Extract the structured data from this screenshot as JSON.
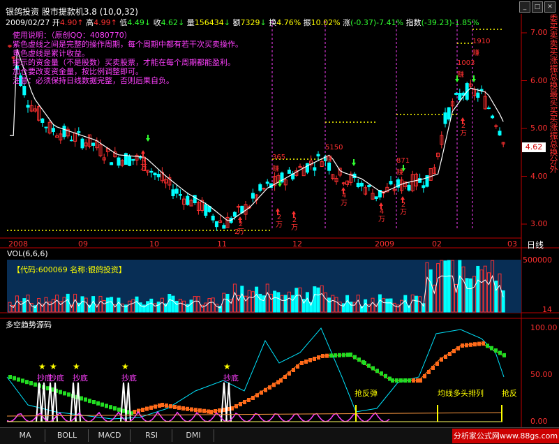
{
  "header": {
    "stock": "银鸽投资",
    "indicator": "股市提款机3.8 (10,0,32)",
    "date": "2009/02/27",
    "open_label": "开",
    "open": "4.90",
    "high_label": "高",
    "high": "4.99",
    "low_label": "低",
    "low": "4.49",
    "close_label": "收",
    "close": "4.62",
    "vol_label": "量",
    "vol": "156434",
    "amount_label": "额",
    "amount": "7329",
    "turnover_label": "换",
    "turnover": "4.76%",
    "amplitude_label": "振",
    "amplitude": "10.02%",
    "change_label": "涨",
    "change": "(-0.37)-7.41%",
    "index_label": "指数",
    "index": "(-39.23)-1.85%"
  },
  "usage_notes": [
    "使用说明：（原创QQ：4080770）",
    "紫色虚线之间是完整的操作周期，每个周期中都有若干次买卖操作。",
    "黄色虚线是累计收益。",
    "提示的资金量（不是股数）买卖股票，才能在每个周期都能盈利。",
    "加仓要改变资金量，按比例调整即可。",
    "注意：必须保持日线数据完整，否则后果自负。"
  ],
  "price_axis": [
    "7.00",
    "6.00",
    "5.00",
    "4.00",
    "3.00"
  ],
  "current_price": "4.62",
  "x_axis": [
    "2008",
    "09",
    "10",
    "11",
    "12",
    "2009",
    "02",
    "03"
  ],
  "period_label": "日线",
  "profit_labels": [
    "2",
    "365",
    "5150",
    "871",
    "1003",
    "1910"
  ],
  "zhuan": "赚",
  "buy_signals": [
    {
      "n": "4",
      "unit": "万"
    },
    {
      "n": "2",
      "unit": "万"
    },
    {
      "n": "2",
      "unit": "万"
    },
    {
      "n": "4",
      "unit": "万"
    },
    {
      "n": "4",
      "unit": "万"
    },
    {
      "n": "2",
      "unit": "万"
    },
    {
      "n": "2",
      "unit": "万"
    },
    {
      "n": "2",
      "unit": "万"
    }
  ],
  "volume": {
    "title": "VOL(6,6,6)",
    "info": "【代码:600069 名称:银鸽投资】",
    "axis_top": "500000",
    "axis_bottom": "14"
  },
  "trend": {
    "title": "多空趋势源码",
    "axis": [
      "100.00",
      "50.00",
      "0.00"
    ],
    "star": "★",
    "chaodi": "抄底",
    "qiangfantan": "抢反弹",
    "junxian": "均线多头排列",
    "qiangfan_cut": "抢反"
  },
  "right_strip": "委买卖卖买涨振总换最买买买涨振总换分外",
  "tabs": [
    "MA",
    "BOLL",
    "MACD",
    "RSI",
    "DMI"
  ],
  "watermark": "分析家公式网www.88gs.com",
  "colors": {
    "up": "#ff3030",
    "down": "#00ffff",
    "ma": "#ffffff",
    "profit": "#ffff00",
    "cycle": "#ff40ff"
  }
}
